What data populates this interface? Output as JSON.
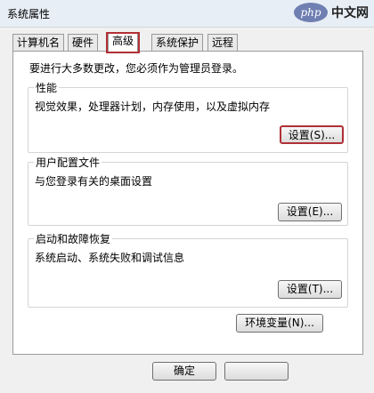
{
  "window": {
    "title": "系统属性"
  },
  "watermark": {
    "logo": "php",
    "text": "中文网"
  },
  "tabs": [
    {
      "label": "计算机名"
    },
    {
      "label": "硬件"
    },
    {
      "label": "高级"
    },
    {
      "label": "系统保护"
    },
    {
      "label": "远程"
    }
  ],
  "advanced": {
    "notice": "要进行大多数更改，您必须作为管理员登录。",
    "performance": {
      "title": "性能",
      "description": "视觉效果，处理器计划，内存使用，以及虚拟内存",
      "button": "设置(S)..."
    },
    "user_profiles": {
      "title": "用户配置文件",
      "description": "与您登录有关的桌面设置",
      "button": "设置(E)..."
    },
    "startup_recovery": {
      "title": "启动和故障恢复",
      "description": "系统启动、系统失败和调试信息",
      "button": "设置(T)..."
    },
    "env_button": "环境变量(N)..."
  },
  "footer": {
    "ok": "确定"
  }
}
